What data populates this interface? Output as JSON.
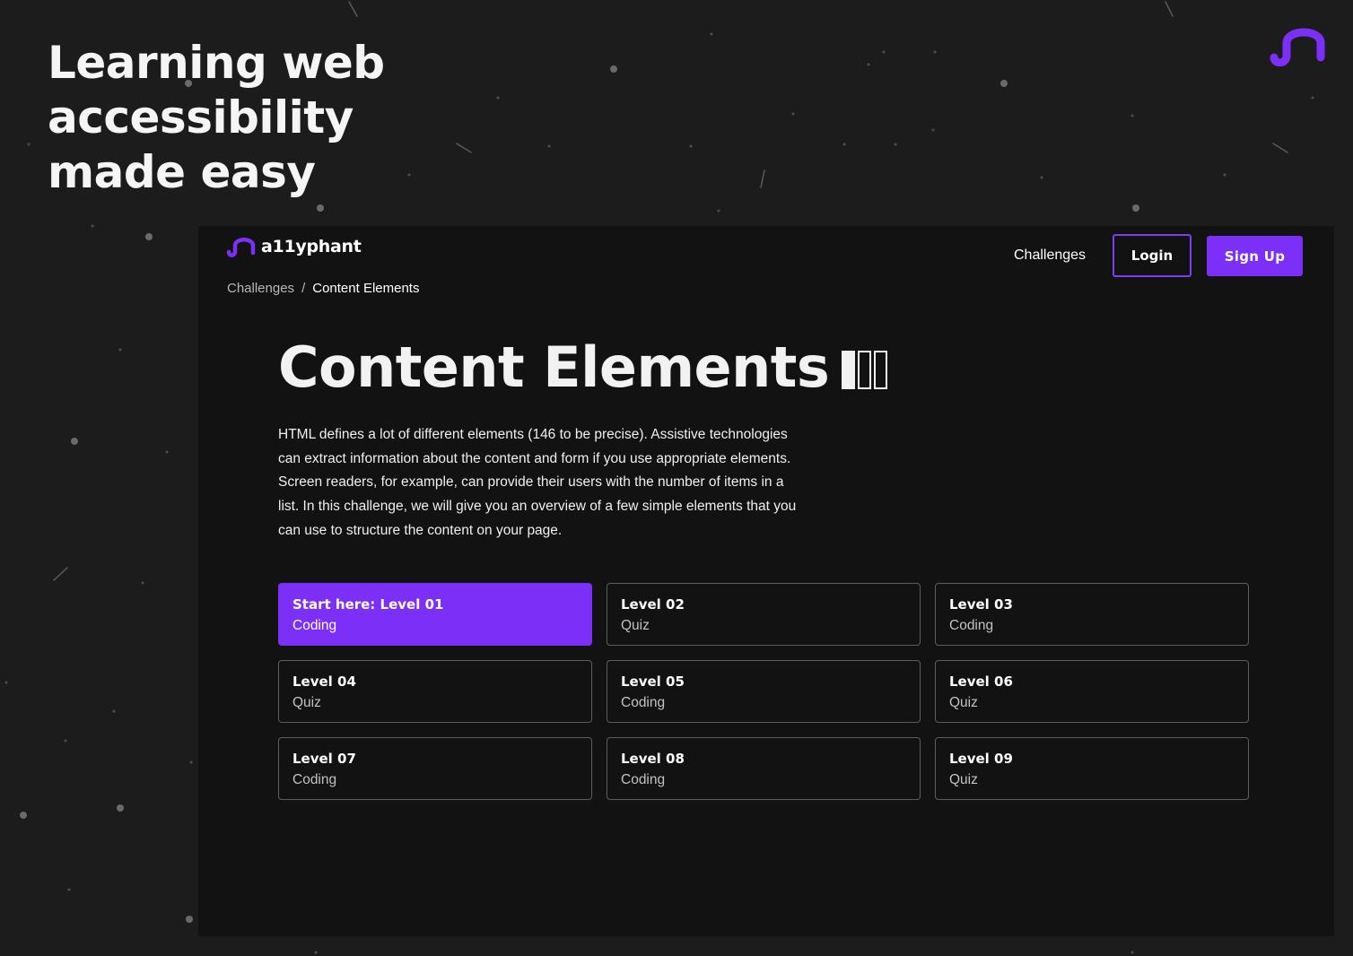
{
  "hero": {
    "heading_line1": "Learning web",
    "heading_line2": "accessibility",
    "heading_line3": "made easy"
  },
  "colors": {
    "background": "#1c1c1d",
    "panel": "#121212",
    "accent": "#7b2ff7"
  },
  "header": {
    "logo_text": "a11yphant",
    "nav_challenges": "Challenges",
    "login_label": "Login",
    "signup_label": "Sign Up"
  },
  "breadcrumb": {
    "parent": "Challenges",
    "separator": "/",
    "current": "Content Elements"
  },
  "main": {
    "title": "Content Elements",
    "title_icon": "content-elements-icon",
    "description": "HTML defines a lot of different elements (146 to be precise). Assistive technologies can extract information about the content and form if you use appropriate elements. Screen readers, for example, can provide their users with the number of items in a list. In this challenge, we will give you an overview of a few simple elements that you can use to structure the content on your page.",
    "levels": [
      {
        "name": "Start here: Level 01",
        "type": "Coding"
      },
      {
        "name": "Level 02",
        "type": "Quiz"
      },
      {
        "name": "Level 03",
        "type": "Coding"
      },
      {
        "name": "Level 04",
        "type": "Quiz"
      },
      {
        "name": "Level 05",
        "type": "Coding"
      },
      {
        "name": "Level 06",
        "type": "Quiz"
      },
      {
        "name": "Level 07",
        "type": "Coding"
      },
      {
        "name": "Level 08",
        "type": "Coding"
      },
      {
        "name": "Level 09",
        "type": "Quiz"
      }
    ]
  }
}
